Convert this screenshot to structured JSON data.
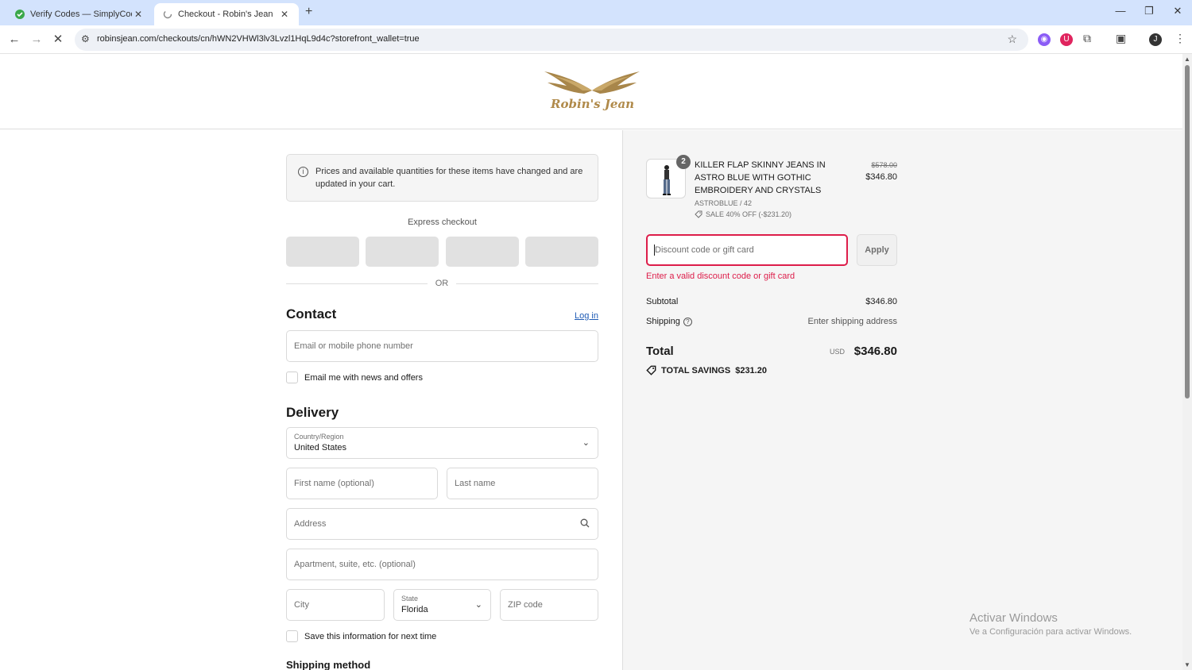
{
  "browser": {
    "tabs": [
      {
        "title": "Verify Codes — SimplyCodes",
        "active": false
      },
      {
        "title": "Checkout - Robin's Jean",
        "active": true
      }
    ],
    "url": "robinsjean.com/checkouts/cn/hWN2VHWl3lv3Lvzl1HqL9d4c?storefront_wallet=true",
    "profile_initial": "J"
  },
  "brand": {
    "logo_text": "Robin's Jean",
    "accent": "#b08a4a"
  },
  "notice": "Prices and available quantities for these items have changed and are updated in your cart.",
  "express": {
    "label": "Express checkout",
    "or": "OR"
  },
  "contact": {
    "heading": "Contact",
    "login": "Log in",
    "email_placeholder": "Email or mobile phone number",
    "news_label": "Email me with news and offers"
  },
  "delivery": {
    "heading": "Delivery",
    "country_label": "Country/Region",
    "country_value": "United States",
    "first_name_placeholder": "First name (optional)",
    "last_name_placeholder": "Last name",
    "address_placeholder": "Address",
    "apartment_placeholder": "Apartment, suite, etc. (optional)",
    "city_placeholder": "City",
    "state_label": "State",
    "state_value": "Florida",
    "zip_placeholder": "ZIP code",
    "save_label": "Save this information for next time"
  },
  "shipping_method": {
    "heading": "Shipping method"
  },
  "order": {
    "quantity": "2",
    "product_name": "KILLER FLAP SKINNY JEANS IN ASTRO BLUE WITH GOTHIC EMBROIDERY AND CRYSTALS",
    "variant": "ASTROBLUE / 42",
    "sale": "SALE 40% OFF (-$231.20)",
    "price_old": "$578.00",
    "price_new": "$346.80",
    "discount_placeholder": "Discount code or gift card",
    "apply": "Apply",
    "error": "Enter a valid discount code or gift card",
    "subtotal_label": "Subtotal",
    "subtotal_value": "$346.80",
    "shipping_label": "Shipping",
    "shipping_value": "Enter shipping address",
    "total_label": "Total",
    "currency": "USD",
    "total_value": "$346.80",
    "savings_label": "TOTAL SAVINGS",
    "savings_value": "$231.20",
    "error_color": "#dd1d4a"
  },
  "watermark": {
    "line1": "Activar Windows",
    "line2": "Ve a Configuración para activar Windows."
  }
}
